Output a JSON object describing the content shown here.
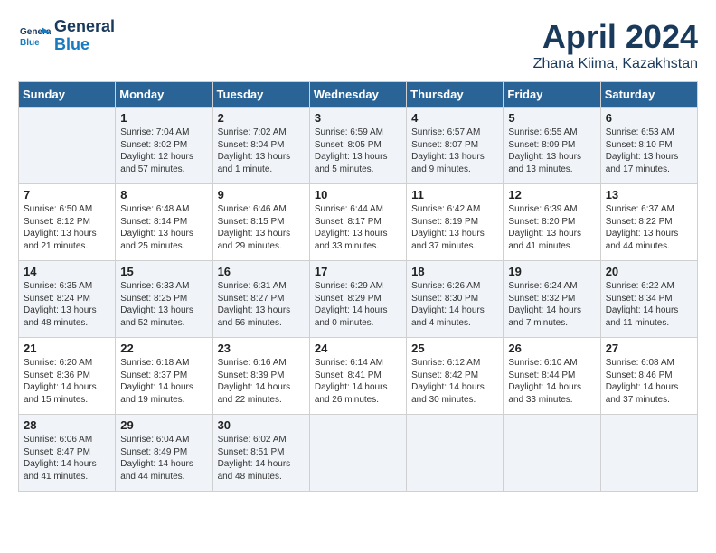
{
  "logo": {
    "line1": "General",
    "line2": "Blue"
  },
  "title": "April 2024",
  "location": "Zhana Kiima, Kazakhstan",
  "days_header": [
    "Sunday",
    "Monday",
    "Tuesday",
    "Wednesday",
    "Thursday",
    "Friday",
    "Saturday"
  ],
  "weeks": [
    [
      {
        "num": "",
        "info": ""
      },
      {
        "num": "1",
        "info": "Sunrise: 7:04 AM\nSunset: 8:02 PM\nDaylight: 12 hours\nand 57 minutes."
      },
      {
        "num": "2",
        "info": "Sunrise: 7:02 AM\nSunset: 8:04 PM\nDaylight: 13 hours\nand 1 minute."
      },
      {
        "num": "3",
        "info": "Sunrise: 6:59 AM\nSunset: 8:05 PM\nDaylight: 13 hours\nand 5 minutes."
      },
      {
        "num": "4",
        "info": "Sunrise: 6:57 AM\nSunset: 8:07 PM\nDaylight: 13 hours\nand 9 minutes."
      },
      {
        "num": "5",
        "info": "Sunrise: 6:55 AM\nSunset: 8:09 PM\nDaylight: 13 hours\nand 13 minutes."
      },
      {
        "num": "6",
        "info": "Sunrise: 6:53 AM\nSunset: 8:10 PM\nDaylight: 13 hours\nand 17 minutes."
      }
    ],
    [
      {
        "num": "7",
        "info": "Sunrise: 6:50 AM\nSunset: 8:12 PM\nDaylight: 13 hours\nand 21 minutes."
      },
      {
        "num": "8",
        "info": "Sunrise: 6:48 AM\nSunset: 8:14 PM\nDaylight: 13 hours\nand 25 minutes."
      },
      {
        "num": "9",
        "info": "Sunrise: 6:46 AM\nSunset: 8:15 PM\nDaylight: 13 hours\nand 29 minutes."
      },
      {
        "num": "10",
        "info": "Sunrise: 6:44 AM\nSunset: 8:17 PM\nDaylight: 13 hours\nand 33 minutes."
      },
      {
        "num": "11",
        "info": "Sunrise: 6:42 AM\nSunset: 8:19 PM\nDaylight: 13 hours\nand 37 minutes."
      },
      {
        "num": "12",
        "info": "Sunrise: 6:39 AM\nSunset: 8:20 PM\nDaylight: 13 hours\nand 41 minutes."
      },
      {
        "num": "13",
        "info": "Sunrise: 6:37 AM\nSunset: 8:22 PM\nDaylight: 13 hours\nand 44 minutes."
      }
    ],
    [
      {
        "num": "14",
        "info": "Sunrise: 6:35 AM\nSunset: 8:24 PM\nDaylight: 13 hours\nand 48 minutes."
      },
      {
        "num": "15",
        "info": "Sunrise: 6:33 AM\nSunset: 8:25 PM\nDaylight: 13 hours\nand 52 minutes."
      },
      {
        "num": "16",
        "info": "Sunrise: 6:31 AM\nSunset: 8:27 PM\nDaylight: 13 hours\nand 56 minutes."
      },
      {
        "num": "17",
        "info": "Sunrise: 6:29 AM\nSunset: 8:29 PM\nDaylight: 14 hours\nand 0 minutes."
      },
      {
        "num": "18",
        "info": "Sunrise: 6:26 AM\nSunset: 8:30 PM\nDaylight: 14 hours\nand 4 minutes."
      },
      {
        "num": "19",
        "info": "Sunrise: 6:24 AM\nSunset: 8:32 PM\nDaylight: 14 hours\nand 7 minutes."
      },
      {
        "num": "20",
        "info": "Sunrise: 6:22 AM\nSunset: 8:34 PM\nDaylight: 14 hours\nand 11 minutes."
      }
    ],
    [
      {
        "num": "21",
        "info": "Sunrise: 6:20 AM\nSunset: 8:36 PM\nDaylight: 14 hours\nand 15 minutes."
      },
      {
        "num": "22",
        "info": "Sunrise: 6:18 AM\nSunset: 8:37 PM\nDaylight: 14 hours\nand 19 minutes."
      },
      {
        "num": "23",
        "info": "Sunrise: 6:16 AM\nSunset: 8:39 PM\nDaylight: 14 hours\nand 22 minutes."
      },
      {
        "num": "24",
        "info": "Sunrise: 6:14 AM\nSunset: 8:41 PM\nDaylight: 14 hours\nand 26 minutes."
      },
      {
        "num": "25",
        "info": "Sunrise: 6:12 AM\nSunset: 8:42 PM\nDaylight: 14 hours\nand 30 minutes."
      },
      {
        "num": "26",
        "info": "Sunrise: 6:10 AM\nSunset: 8:44 PM\nDaylight: 14 hours\nand 33 minutes."
      },
      {
        "num": "27",
        "info": "Sunrise: 6:08 AM\nSunset: 8:46 PM\nDaylight: 14 hours\nand 37 minutes."
      }
    ],
    [
      {
        "num": "28",
        "info": "Sunrise: 6:06 AM\nSunset: 8:47 PM\nDaylight: 14 hours\nand 41 minutes."
      },
      {
        "num": "29",
        "info": "Sunrise: 6:04 AM\nSunset: 8:49 PM\nDaylight: 14 hours\nand 44 minutes."
      },
      {
        "num": "30",
        "info": "Sunrise: 6:02 AM\nSunset: 8:51 PM\nDaylight: 14 hours\nand 48 minutes."
      },
      {
        "num": "",
        "info": ""
      },
      {
        "num": "",
        "info": ""
      },
      {
        "num": "",
        "info": ""
      },
      {
        "num": "",
        "info": ""
      }
    ]
  ]
}
